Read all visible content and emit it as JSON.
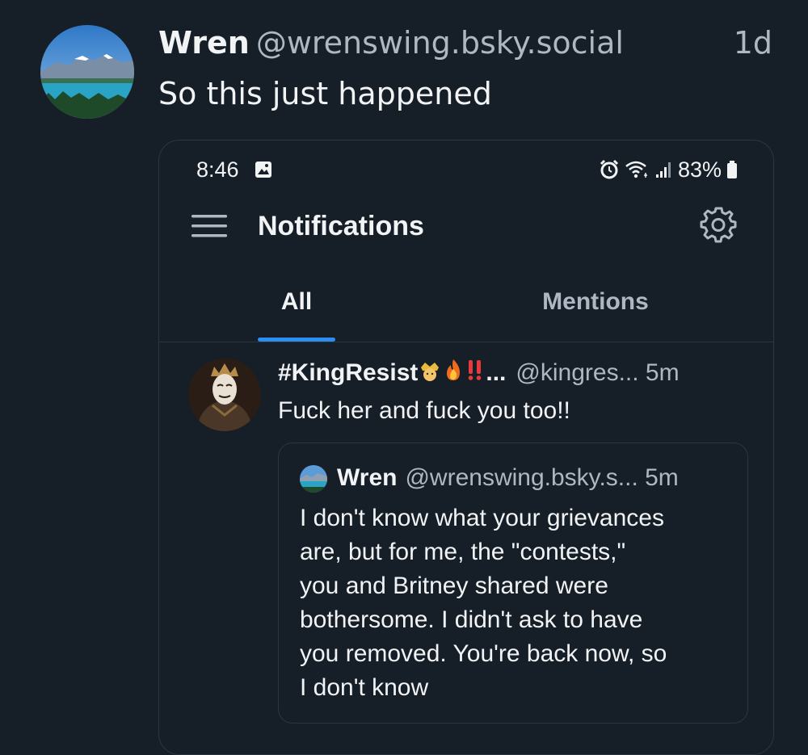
{
  "post": {
    "author_name": "Wren",
    "author_handle": "@wrenswing.bsky.social",
    "time": "1d",
    "text": "So this just happened"
  },
  "screenshot": {
    "status_bar": {
      "time": "8:46",
      "battery": "83%",
      "icons": [
        "image-icon",
        "alarm-icon",
        "wifi-icon",
        "signal-icon",
        "battery-icon"
      ]
    },
    "app_bar": {
      "title": "Notifications",
      "icons": [
        "hamburger-menu-icon",
        "gear-icon"
      ]
    },
    "tabs": [
      "All",
      "Mentions"
    ],
    "notification": {
      "user_name": "#KingResist",
      "emojis": [
        "crown-emoji",
        "fire-emoji",
        "double-exclamation-emoji"
      ],
      "ellipsis": "...",
      "handle": "@kingres... 5m",
      "text": "Fuck her and fuck you too!!"
    },
    "quoted_post": {
      "author_name": "Wren",
      "author_handle": "@wrenswing.bsky.s... 5m",
      "text_lines": [
        "I don't know what your grievances",
        "are, but for me, the \"contests,\"",
        "you and Britney shared were",
        "bothersome. I didn't ask to have",
        "you removed. You're back now, so",
        "I don't know"
      ]
    }
  },
  "colors": {
    "background": "#161e27",
    "text_primary": "#f1f3f5",
    "text_secondary": "#aeb7c2",
    "border": "#2c3641",
    "accent": "#2b8ef0"
  }
}
